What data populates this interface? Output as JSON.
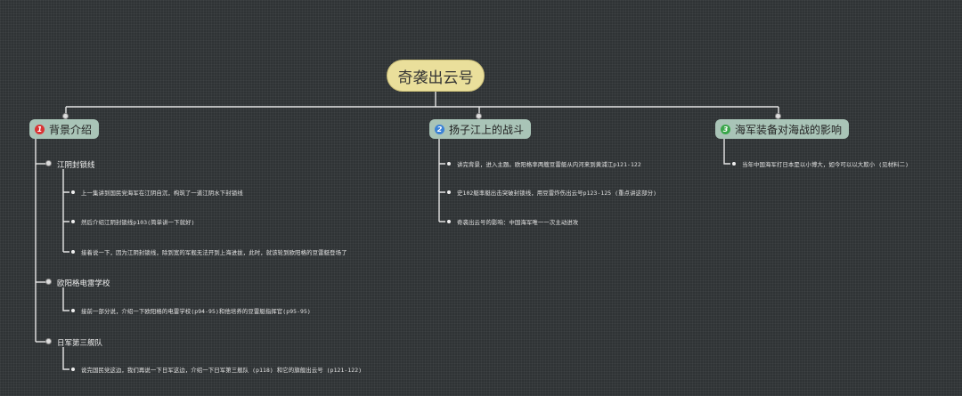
{
  "root": {
    "title": "奇袭出云号"
  },
  "colors": {
    "badge1": "#d93434",
    "badge2": "#3b82d6",
    "badge3": "#3aa64a",
    "branch_bg": "#a9c4b7",
    "root_bg": "#eadf9b",
    "line": "#e6e6e6"
  },
  "branches": [
    {
      "badge": "1",
      "label": "背景介绍",
      "subs": [
        {
          "label": "江阴封锁线",
          "leaves": [
            "上一集讲到国民党海军在江阴自沉，构筑了一道江阴水下封锁线",
            "然后介绍江阴封锁线p103(简单讲一下就好)",
            "接着说一下，因为江阴封锁线，除到宽的军舰无法开到上海进拢，此时，就该轮到欧阳格的豆雷艇登场了"
          ]
        },
        {
          "label": "欧阳格电雷学校",
          "leaves": [
            "接前一部分说，介绍一下欧阳格的电雷学校(p94-95)和他培养的豆雷艇指挥官(p95-95)"
          ]
        },
        {
          "label": "日军第三舰队",
          "leaves": [
            "说完国民党这边，我们再说一下日军这边，介绍一下日军第三舰队 (p118) 和它的旗舰出云号 (p121-122)"
          ]
        }
      ]
    },
    {
      "badge": "2",
      "label": "扬子江上的战斗",
      "leaves": [
        "讲完背景，进入主题。欧阳格率两艘豆雷艇从内河来到黄浦江p121-122",
        "史102艇率艇出击突破封锁线，用豆雷炸伤出云号p123-125 (重点讲这部分)",
        "奇袭出云号的影响：中国海军唯一一次主动进攻"
      ]
    },
    {
      "badge": "3",
      "label": "海军装备对海战的影响",
      "leaves": [
        "当年中国海军打日本是以小博大，如今可以以大欺小 (见材料二)"
      ]
    }
  ]
}
